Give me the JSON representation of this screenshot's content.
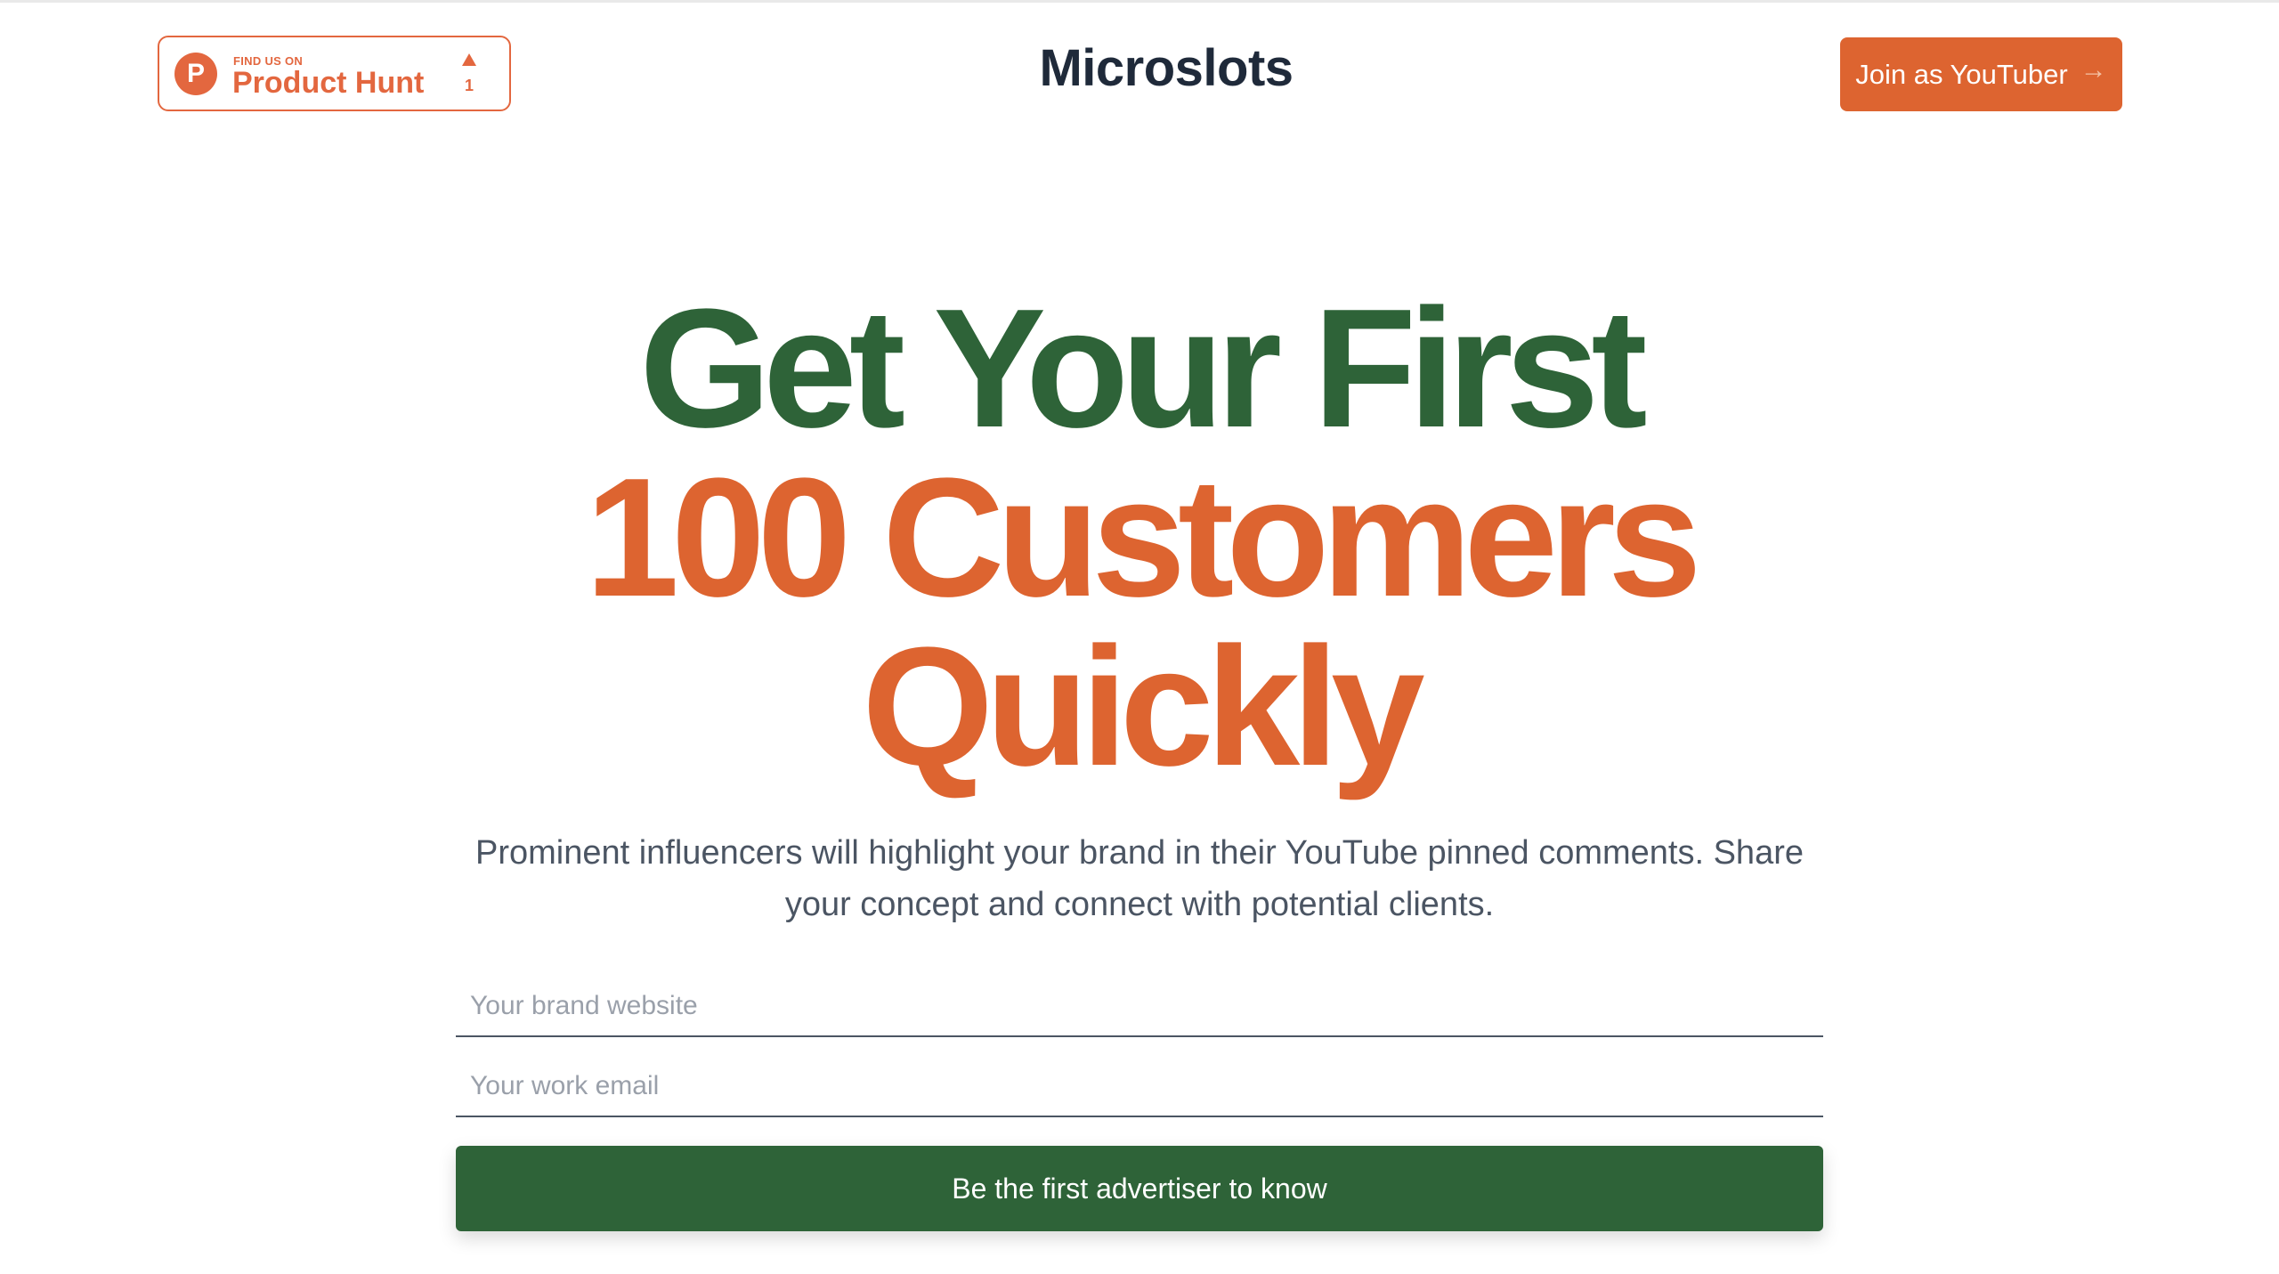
{
  "header": {
    "product_hunt": {
      "small_label": "FIND US ON",
      "name": "Product Hunt",
      "logo_letter": "P",
      "upvotes": "1"
    },
    "brand": "Microslots",
    "join_button": "Join as YouTuber",
    "join_arrow": "→"
  },
  "hero": {
    "line1": "Get Your First",
    "line2": "100 Customers",
    "line3": "Quickly",
    "subtext": "Prominent influencers will highlight your brand in their YouTube pinned comments. Share your concept and connect with potential clients."
  },
  "form": {
    "website_placeholder": "Your brand website",
    "email_placeholder": "Your work email",
    "submit_label": "Be the first advertiser to know"
  },
  "colors": {
    "green": "#2e6338",
    "orange": "#dd6430",
    "product_hunt": "#e3673f"
  }
}
